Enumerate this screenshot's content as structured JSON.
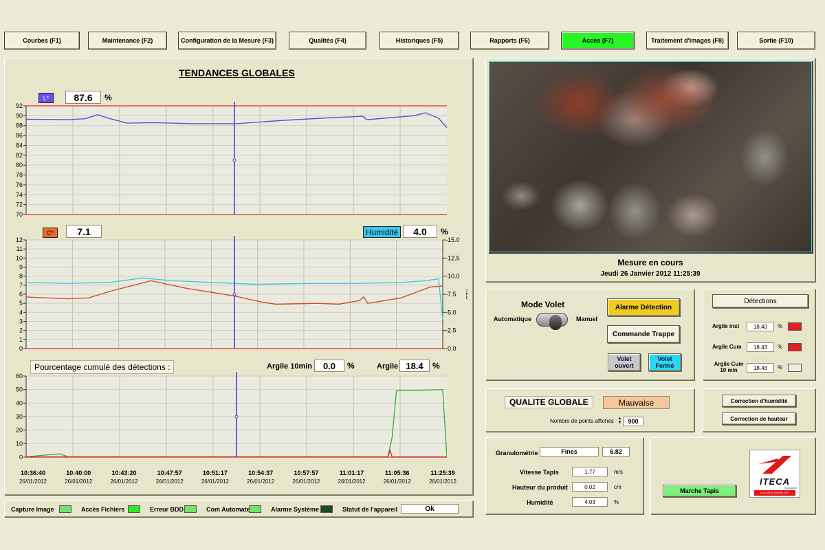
{
  "nav": [
    {
      "label": "Courbes (F1)"
    },
    {
      "label": "Maintenance (F2)"
    },
    {
      "label": "Configuration de la Mesure (F3)"
    },
    {
      "label": "Qualités (F4)"
    },
    {
      "label": "Historiques (F5)"
    },
    {
      "label": "Rapports (F6)"
    },
    {
      "label": "Accès (F7)",
      "active": true
    },
    {
      "label": "Traitement d'images (F8)"
    },
    {
      "label": "Sortie (F10)"
    }
  ],
  "trends": {
    "title": "TENDANCES GLOBALES",
    "l_label": "L*",
    "l_value": "87.6",
    "l_unit": "%",
    "c_label": "C*",
    "c_value": "7.1",
    "hum_label": "Humidité",
    "hum_value": "4.0",
    "hum_unit": "%",
    "cumul_label": "Pourcentage cumulé des détections :",
    "argile10_label": "Argile 10min",
    "argile10_value": "0.0",
    "argile10_unit": "%",
    "argile_label": "Argile",
    "argile_value": "18.4",
    "argile_unit": "%",
    "h2o_label": "H2O",
    "time_ticks": [
      {
        "time": "10:36:40",
        "date": "26/01/2012"
      },
      {
        "time": "10:40:00",
        "date": "26/01/2012"
      },
      {
        "time": "10:43:20",
        "date": "26/01/2012"
      },
      {
        "time": "10:47:57",
        "date": "26/01/2012"
      },
      {
        "time": "10:51:17",
        "date": "26/01/2012"
      },
      {
        "time": "10:54:37",
        "date": "26/01/2012"
      },
      {
        "time": "10:57:57",
        "date": "26/01/2012"
      },
      {
        "time": "11:01:17",
        "date": "26/01/2012"
      },
      {
        "time": "11:05:36",
        "date": "26/01/2012"
      },
      {
        "time": "11:25:39",
        "date": "26/01/2012"
      }
    ]
  },
  "chart_data": [
    {
      "type": "line",
      "name": "L* chart",
      "ylim": [
        70,
        92
      ],
      "yticks": [
        70,
        72,
        74,
        76,
        78,
        80,
        82,
        84,
        86,
        88,
        90,
        92
      ],
      "limit_lines": [
        92,
        70
      ],
      "cursor_x": 0.495,
      "series": [
        {
          "name": "L*",
          "color": "#5a50d8",
          "points": [
            [
              0,
              89.3
            ],
            [
              0.1,
              89.2
            ],
            [
              0.14,
              89.4
            ],
            [
              0.17,
              90.2
            ],
            [
              0.2,
              89.4
            ],
            [
              0.24,
              88.5
            ],
            [
              0.3,
              88.6
            ],
            [
              0.4,
              88.4
            ],
            [
              0.5,
              88.4
            ],
            [
              0.6,
              89.0
            ],
            [
              0.7,
              89.5
            ],
            [
              0.8,
              89.9
            ],
            [
              0.81,
              89.2
            ],
            [
              0.85,
              89.5
            ],
            [
              0.92,
              90.0
            ],
            [
              0.95,
              90.6
            ],
            [
              0.98,
              89.5
            ],
            [
              1.0,
              87.6
            ]
          ]
        }
      ]
    },
    {
      "type": "line",
      "name": "C* / Humidite chart",
      "ylim": [
        0,
        12
      ],
      "yticks": [
        0,
        1,
        2,
        3,
        4,
        5,
        6,
        7,
        8,
        9,
        10,
        11,
        12
      ],
      "y2lim": [
        0,
        15
      ],
      "y2ticks": [
        "0.0",
        "2.5",
        "5.0",
        "7.5",
        "10.0",
        "12.5",
        "15.0"
      ],
      "cursor_x": 0.5,
      "series": [
        {
          "name": "C*",
          "color": "#c8502a",
          "points": [
            [
              0,
              5.7
            ],
            [
              0.1,
              5.5
            ],
            [
              0.15,
              5.6
            ],
            [
              0.2,
              6.3
            ],
            [
              0.3,
              7.5
            ],
            [
              0.38,
              6.7
            ],
            [
              0.5,
              5.8
            ],
            [
              0.57,
              5.1
            ],
            [
              0.6,
              4.9
            ],
            [
              0.7,
              5.0
            ],
            [
              0.75,
              4.9
            ],
            [
              0.8,
              5.3
            ],
            [
              0.81,
              5.7
            ],
            [
              0.82,
              5.0
            ],
            [
              0.9,
              5.6
            ],
            [
              0.97,
              6.8
            ],
            [
              1.0,
              6.9
            ]
          ]
        },
        {
          "name": "Humidité",
          "color": "#40c8e0",
          "points": [
            [
              0,
              7.3
            ],
            [
              0.1,
              7.2
            ],
            [
              0.2,
              7.3
            ],
            [
              0.28,
              7.8
            ],
            [
              0.35,
              7.5
            ],
            [
              0.45,
              7.3
            ],
            [
              0.55,
              7.1
            ],
            [
              0.7,
              7.2
            ],
            [
              0.8,
              7.2
            ],
            [
              0.9,
              7.3
            ],
            [
              0.96,
              7.5
            ],
            [
              0.99,
              7.7
            ],
            [
              1.0,
              3.2
            ]
          ]
        }
      ]
    },
    {
      "type": "line",
      "name": "Detections cumul chart",
      "ylim": [
        0,
        60
      ],
      "yticks": [
        0,
        10,
        20,
        30,
        40,
        50,
        60
      ],
      "cursor_x": 0.5,
      "series": [
        {
          "name": "Argile",
          "color": "#3bb53b",
          "points": [
            [
              0,
              0.3
            ],
            [
              0.08,
              2.5
            ],
            [
              0.1,
              0.3
            ],
            [
              0.86,
              0.3
            ],
            [
              0.87,
              15
            ],
            [
              0.88,
              49
            ],
            [
              0.99,
              50
            ],
            [
              1.0,
              0.3
            ]
          ]
        },
        {
          "name": "Argile 10min",
          "color": "#c83020",
          "points": [
            [
              0,
              0.2
            ],
            [
              0.86,
              0.2
            ],
            [
              0.865,
              5
            ],
            [
              0.87,
              0.2
            ],
            [
              1.0,
              0.2
            ]
          ]
        }
      ]
    }
  ],
  "status": {
    "items": [
      {
        "label": "Capture Image",
        "color": "#6fe36f"
      },
      {
        "label": "Accès Fichiers",
        "color": "#2ee82e"
      },
      {
        "label": "Erreur BDD",
        "color": "#6fe36f"
      },
      {
        "label": "Com Automate",
        "color": "#6fe36f"
      },
      {
        "label": "Alarme Système",
        "color": "#1f4a1f"
      }
    ],
    "device_label": "Statut de l'appareil",
    "device_value": "Ok"
  },
  "camera": {
    "status": "Mesure en cours",
    "datetime": "Jeudi 26 Janvier 2012 11:25:39"
  },
  "volet": {
    "title": "Mode Volet",
    "auto_label": "Automatique",
    "manual_label": "Manuel",
    "alarm_button": "Alarme Détection",
    "trappe_button": "Commande Trappe",
    "open_button": "Volet ouvert",
    "closed_button": "Volet Fermé"
  },
  "detections": {
    "title": "Détections",
    "rows": [
      {
        "label": "Argile inst",
        "value": "18.43",
        "unit": "%",
        "color": "#e02020"
      },
      {
        "label": "Argile Cum",
        "value": "18.43",
        "unit": "%",
        "color": "#e02020"
      },
      {
        "label": "Argile Cum 10 min",
        "value": "18.43",
        "unit": "%",
        "color": "#efefe2"
      }
    ]
  },
  "quality": {
    "title": "QUALITE GLOBALE",
    "value": "Mauvaise",
    "points_label": "Nombre de points affichés",
    "points_value": "900"
  },
  "corrections": {
    "humidity_button": "Correction d'humidité",
    "height_button": "Correction de hauteur"
  },
  "measures": {
    "granulo_label": "Granulométrie",
    "granulo_class": "Fines",
    "granulo_value": "6.82",
    "speed_label": "Vitesse Tapis",
    "speed_value": "1.77",
    "speed_unit": "m/s",
    "height_label": "Hauteur du produit",
    "height_value": "0.02",
    "height_unit": "cm",
    "humidity_label": "Humidité",
    "humidity_value": "4.03",
    "humidity_unit": "%"
  },
  "brand": {
    "name": "ITECA",
    "sub": "SOCADEI",
    "tagline": "COLOR & VISION OPT"
  },
  "conveyor": {
    "button": "Marche Tapis"
  }
}
